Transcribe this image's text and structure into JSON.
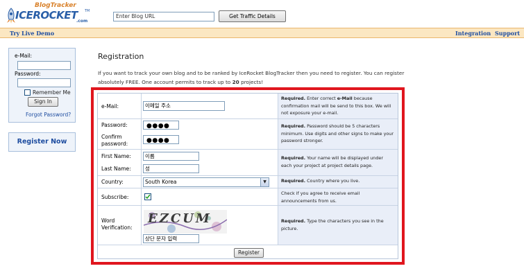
{
  "header": {
    "logo_top": "BlogTracker",
    "logo_main": "ICEROCKET",
    "logo_tm": "TM",
    "logo_com": ".com",
    "url_placeholder": "Enter Blog URL",
    "get_traffic_label": "Get Traffic Details"
  },
  "nav": {
    "try_live_demo": "Try Live Demo",
    "integration": "Integration",
    "support": "Support"
  },
  "login": {
    "email_label": "e-Mail:",
    "password_label": "Password:",
    "remember_label": "Remember Me",
    "signin_label": "Sign In",
    "forgot_label": "Forgot Password?"
  },
  "sidebar": {
    "register_now_label": "Register Now"
  },
  "registration": {
    "title": "Registration",
    "intro_before": "If you want to track your own blog and to be ranked by IceRocket BlogTracker then you need to register. You can register absolutely FREE. One account permits to track up to ",
    "intro_count": "20",
    "intro_after": " projects!",
    "email_label": "e-Mail:",
    "email_value": "이메일 주소",
    "password_label": "Password:",
    "password_dots": "●●●●",
    "confirm_label": "Confirm password:",
    "confirm_dots": "●●●●",
    "first_name_label": "First Name:",
    "first_name_value": "이름",
    "last_name_label": "Last Name:",
    "last_name_value": "성",
    "country_label": "Country:",
    "country_value": "South Korea",
    "subscribe_label": "Subscribe:",
    "word_label": "Word Verification:",
    "captcha_text": "EZCUM",
    "captcha_value": "상단 문자 입력",
    "register_button": "Register",
    "help_required": "Required.",
    "help_email_a": " Enter correct ",
    "help_email_b": "e-Mail",
    "help_email_c": " because confirmation mail will be send to this box. We will not exposure your e-mail.",
    "help_password": " Password should be 5 characters minimum. Use digits and other signs to make your password stronger.",
    "help_name": " Your name will be displayed under each your project at project details page.",
    "help_country": " Country where you live.",
    "help_subscribe": "Check if you agree to receive email announcements from us.",
    "help_captcha": " Type the characters you see in the picture."
  },
  "colors": {
    "accent_red_frame": "#e0161e",
    "nav_background": "#fbe7c2",
    "link_blue": "#1e4da0",
    "help_background": "#e9eef8"
  }
}
